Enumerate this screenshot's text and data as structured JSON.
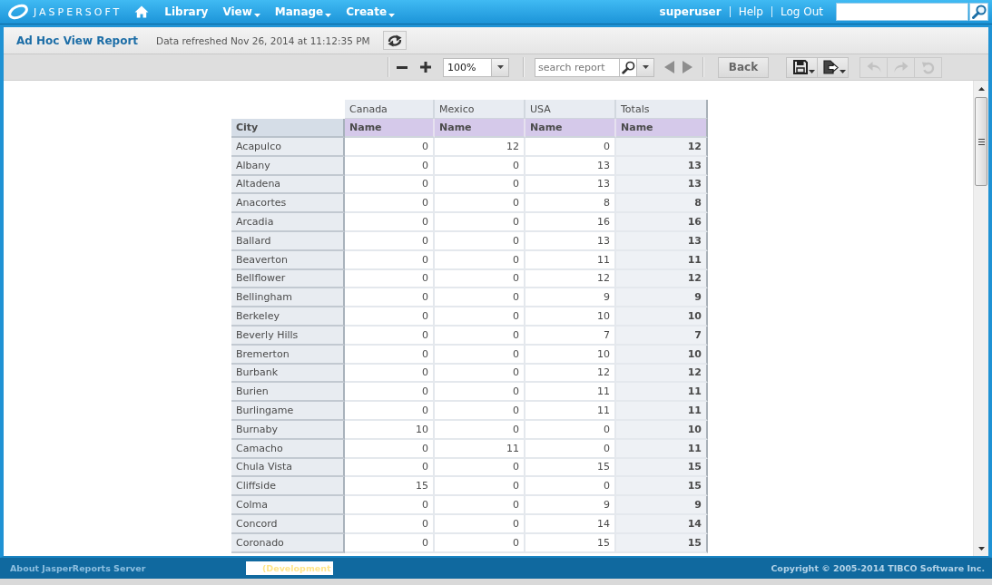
{
  "top_bar": {
    "logo": "JASPERSOFT",
    "menu": [
      {
        "label": "Library",
        "has_menu": false
      },
      {
        "label": "View",
        "has_menu": true
      },
      {
        "label": "Manage",
        "has_menu": true
      },
      {
        "label": "Create",
        "has_menu": true
      }
    ],
    "user": "superuser",
    "links": [
      "Help",
      "Log Out"
    ]
  },
  "page_header": {
    "title": "Ad Hoc View Report",
    "refreshed": "Data refreshed Nov 26, 2014 at 11:12:35 PM"
  },
  "toolbar": {
    "zoom": "100%",
    "search": {
      "placeholder": "search report"
    },
    "page_nav": [
      {
        "kind": "previous",
        "disabled": true
      },
      {
        "kind": "next",
        "disabled": true
      }
    ],
    "back": "Back",
    "file_buttons": [
      {
        "kind": "save"
      },
      {
        "kind": "export"
      }
    ],
    "history_buttons": [
      {
        "kind": "undo",
        "disabled": true
      },
      {
        "kind": "redo",
        "disabled": true
      },
      {
        "kind": "undo_all",
        "disabled": true
      }
    ]
  },
  "table": {
    "column_groups": [
      "Canada",
      "Mexico",
      "USA",
      "Totals"
    ],
    "row_header": "City",
    "measure_headers": [
      "Name",
      "Name",
      "Name",
      "Name"
    ],
    "rows": [
      {
        "city": "Acapulco",
        "values": [
          "0",
          "12",
          "0"
        ],
        "total": "12"
      },
      {
        "city": "Albany",
        "values": [
          "0",
          "0",
          "13"
        ],
        "total": "13"
      },
      {
        "city": "Altadena",
        "values": [
          "0",
          "0",
          "13"
        ],
        "total": "13"
      },
      {
        "city": "Anacortes",
        "values": [
          "0",
          "0",
          "8"
        ],
        "total": "8"
      },
      {
        "city": "Arcadia",
        "values": [
          "0",
          "0",
          "16"
        ],
        "total": "16"
      },
      {
        "city": "Ballard",
        "values": [
          "0",
          "0",
          "13"
        ],
        "total": "13"
      },
      {
        "city": "Beaverton",
        "values": [
          "0",
          "0",
          "11"
        ],
        "total": "11"
      },
      {
        "city": "Bellflower",
        "values": [
          "0",
          "0",
          "12"
        ],
        "total": "12"
      },
      {
        "city": "Bellingham",
        "values": [
          "0",
          "0",
          "9"
        ],
        "total": "9"
      },
      {
        "city": "Berkeley",
        "values": [
          "0",
          "0",
          "10"
        ],
        "total": "10"
      },
      {
        "city": "Beverly Hills",
        "values": [
          "0",
          "0",
          "7"
        ],
        "total": "7"
      },
      {
        "city": "Bremerton",
        "values": [
          "0",
          "0",
          "10"
        ],
        "total": "10"
      },
      {
        "city": "Burbank",
        "values": [
          "0",
          "0",
          "12"
        ],
        "total": "12"
      },
      {
        "city": "Burien",
        "values": [
          "0",
          "0",
          "11"
        ],
        "total": "11"
      },
      {
        "city": "Burlingame",
        "values": [
          "0",
          "0",
          "11"
        ],
        "total": "11"
      },
      {
        "city": "Burnaby",
        "values": [
          "10",
          "0",
          "0"
        ],
        "total": "10"
      },
      {
        "city": "Camacho",
        "values": [
          "0",
          "11",
          "0"
        ],
        "total": "11"
      },
      {
        "city": "Chula Vista",
        "values": [
          "0",
          "0",
          "15"
        ],
        "total": "15"
      },
      {
        "city": "Cliffside",
        "values": [
          "15",
          "0",
          "0"
        ],
        "total": "15"
      },
      {
        "city": "Colma",
        "values": [
          "0",
          "0",
          "9"
        ],
        "total": "9"
      },
      {
        "city": "Concord",
        "values": [
          "0",
          "0",
          "14"
        ],
        "total": "14"
      },
      {
        "city": "Coronado",
        "values": [
          "0",
          "0",
          "15"
        ],
        "total": "15"
      }
    ]
  },
  "footer": {
    "about": "About JasperReports Server",
    "build_note": "(Development",
    "copyright": "Copyright © 2005-2014 TIBCO Software Inc."
  }
}
